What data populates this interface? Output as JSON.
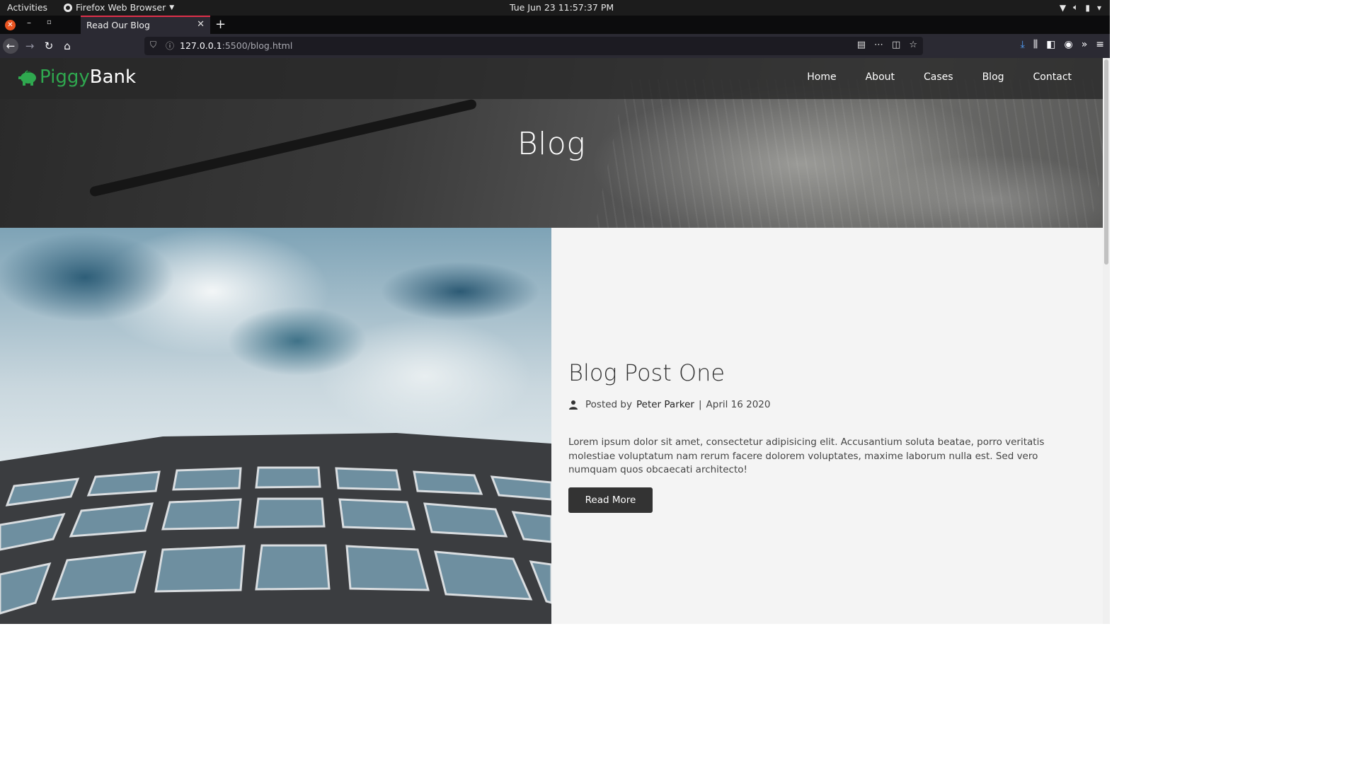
{
  "system_bar": {
    "activities": "Activities",
    "app_name": "Firefox Web Browser",
    "clock": "Tue Jun 23  11:57:37 PM"
  },
  "browser": {
    "tab_title": "Read Our Blog",
    "url_host": "127.0.0.1",
    "url_path": ":5500/blog.html",
    "accent_color": "#e0304a"
  },
  "site": {
    "logo_part1": "Piggy",
    "logo_part2": "Bank",
    "logo_color": "#2fa84f",
    "nav": [
      "Home",
      "About",
      "Cases",
      "Blog",
      "Contact"
    ],
    "hero_title": "Blog"
  },
  "post": {
    "title": "Blog Post One",
    "posted_by_label": "Posted by",
    "author": "Peter Parker",
    "separator": "|",
    "date": "April 16 2020",
    "excerpt": "Lorem ipsum dolor sit amet, consectetur adipisicing elit. Accusantium soluta beatae, porro veritatis molestiae voluptatum nam rerum facere dolorem voluptates, maxime laborum nulla est. Sed vero numquam quos obcaecati architecto!",
    "button_label": "Read More"
  }
}
